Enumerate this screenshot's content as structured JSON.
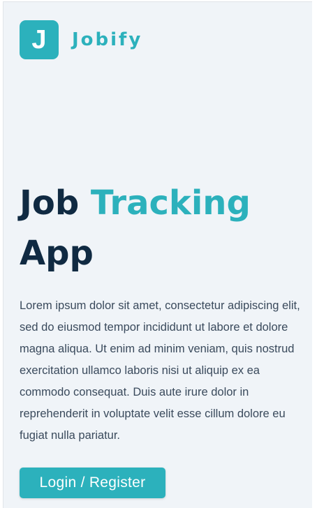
{
  "brand": {
    "logo_letter": "J",
    "name": "Jobify",
    "color": "#2cb1bc"
  },
  "hero": {
    "title_part1": "Job",
    "title_accent": "Tracking",
    "title_part2": "App",
    "description": "Lorem ipsum dolor sit amet, consectetur adipiscing elit, sed do eiusmod tempor incididunt ut labore et dolore magna aliqua. Ut enim ad minim veniam, quis nostrud exercitation ullamco laboris nisi ut aliquip ex ea commodo consequat. Duis aute irure dolor in reprehenderit in voluptate velit esse cillum dolore eu fugiat nulla pariatur.",
    "cta_label": "Login / Register"
  },
  "colors": {
    "background": "#f0f4f8",
    "heading": "#102a42",
    "primary": "#2cb1bc"
  }
}
